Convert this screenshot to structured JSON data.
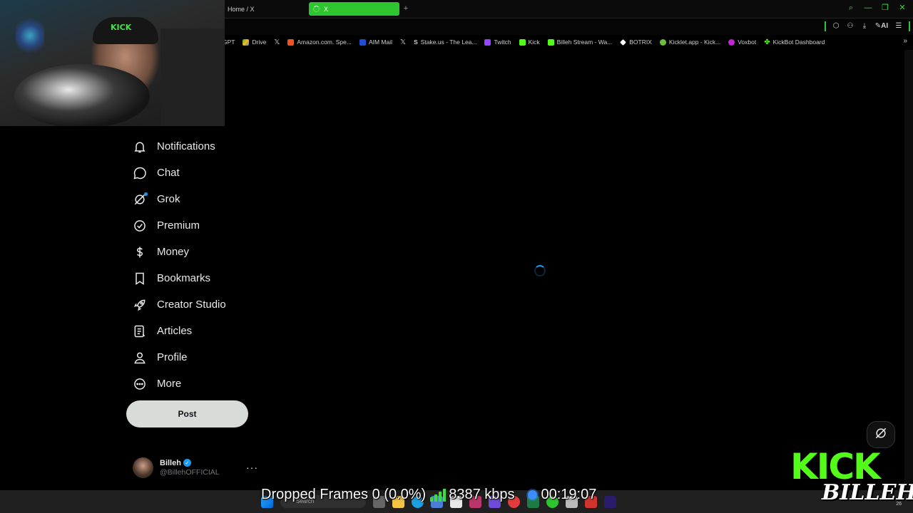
{
  "browser": {
    "tab_home_label": "Home / X",
    "tab_active_label": "X"
  },
  "bookmarks": [
    {
      "label": "GPT",
      "color": ""
    },
    {
      "label": "Drive",
      "color": "#4285f4"
    },
    {
      "label": "",
      "color": "",
      "icon": "x-logo-icon"
    },
    {
      "label": "Amazon.com. Spe...",
      "color": "#f25022"
    },
    {
      "label": "AIM Mail",
      "color": "#1f4fd1"
    },
    {
      "label": "",
      "color": "",
      "icon": "x-logo-icon"
    },
    {
      "label": "Stake.us - The Lea...",
      "color": ""
    },
    {
      "label": "Twitch",
      "color": "#9146ff"
    },
    {
      "label": "Kick",
      "color": "#53fc18"
    },
    {
      "label": "Billeh Stream - Wa...",
      "color": "#53fc18"
    },
    {
      "label": "BOTRIX",
      "color": "#ffffff"
    },
    {
      "label": "Kicklet.app - Kick...",
      "color": "#6bbf3b"
    },
    {
      "label": "Voxbot",
      "color": "#c026d3"
    },
    {
      "label": "KickBot Dashboard",
      "color": "#53fc18"
    }
  ],
  "nav": {
    "items": [
      {
        "label": "Notifications",
        "icon": "bell-icon"
      },
      {
        "label": "Chat",
        "icon": "chat-bubble-icon"
      },
      {
        "label": "Grok",
        "icon": "grok-icon"
      },
      {
        "label": "Premium",
        "icon": "verified-badge-icon"
      },
      {
        "label": "Money",
        "icon": "dollar-icon"
      },
      {
        "label": "Bookmarks",
        "icon": "bookmark-icon"
      },
      {
        "label": "Creator Studio",
        "icon": "rocket-icon"
      },
      {
        "label": "Articles",
        "icon": "article-icon"
      },
      {
        "label": "Profile",
        "icon": "person-icon"
      },
      {
        "label": "More",
        "icon": "more-circle-icon"
      }
    ],
    "post_label": "Post"
  },
  "account": {
    "name": "Billeh",
    "handle": "@BillehOFFICIAL",
    "more": "···"
  },
  "webcam": {
    "hat_text": "KICK"
  },
  "overlay": {
    "kick": "KICK",
    "billeh": "BILLEH",
    "dropped_frames": "Dropped Frames 0 (0.0%)",
    "bitrate": "8387 kbps",
    "timer": "00:19:07"
  },
  "taskbar": {
    "search_placeholder": "Search",
    "time_fragment": "26"
  },
  "colors": {
    "accent_green": "#2ec62e",
    "x_blue": "#1d9bf0",
    "kick_green": "#53fc18"
  }
}
